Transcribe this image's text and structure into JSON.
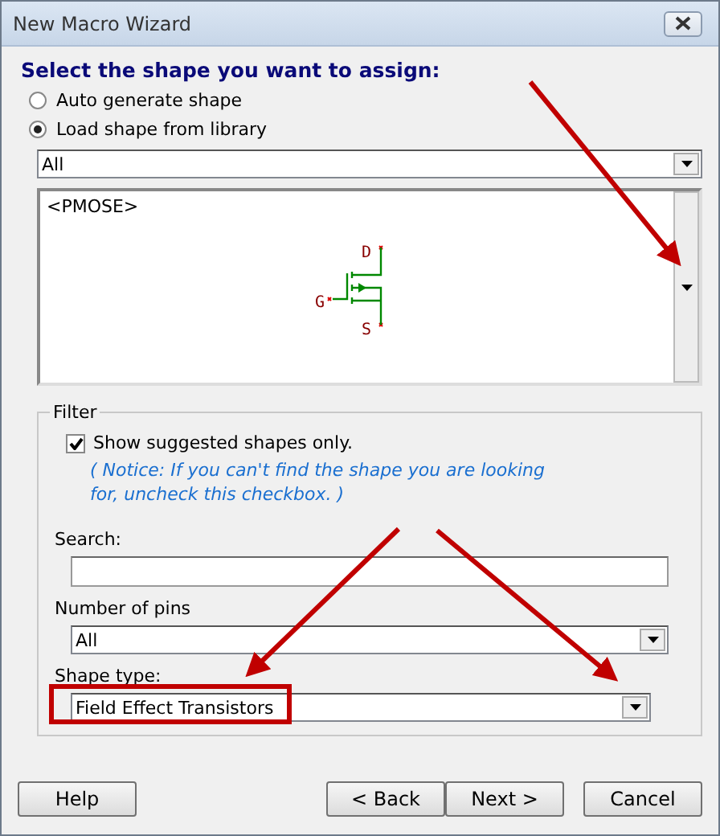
{
  "window": {
    "title": "New Macro Wizard"
  },
  "heading": "Select the shape you want to assign:",
  "shape_source": [
    {
      "label": "Auto generate shape",
      "selected": false
    },
    {
      "label": "Load shape from library",
      "selected": true
    }
  ],
  "library": {
    "value": "All"
  },
  "preview": {
    "name": "<PMOSE>",
    "pins": [
      "D",
      "G",
      "S"
    ]
  },
  "filter": {
    "legend": "Filter",
    "suggested_only": {
      "label": "Show suggested shapes only.",
      "checked": true
    },
    "notice": "( Notice: If you can't find the shape you are looking for, uncheck this checkbox. )",
    "search_label": "Search:",
    "pins_label": "Number of pins",
    "pins_value": "All",
    "shape_type_label": "Shape type:",
    "shape_type_value": "Field Effect Transistors"
  },
  "buttons": [
    {
      "label": "Help",
      "kind": "help"
    },
    {
      "label": "< Back",
      "kind": "nav"
    },
    {
      "label": "Next >",
      "kind": "nav"
    },
    {
      "label": "Cancel",
      "kind": "cancel"
    }
  ]
}
